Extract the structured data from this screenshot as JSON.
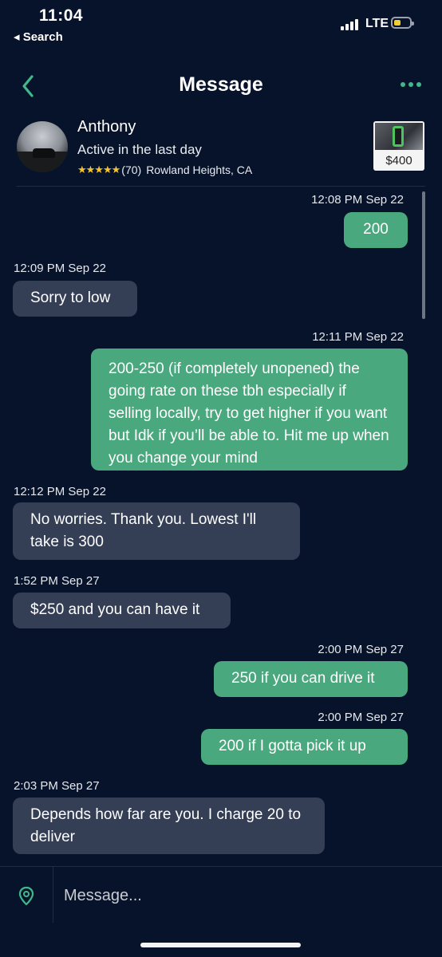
{
  "status_bar": {
    "time": "11:04",
    "back_label": "◂ Search",
    "network": "LTE",
    "battery_color": "#f3cf2b"
  },
  "nav": {
    "title": "Message",
    "accent_color": "#3fb88a"
  },
  "profile": {
    "name": "Anthony",
    "activity": "Active in the last day",
    "stars": "★★★★★",
    "rating_count": "(70)",
    "location": "Rowland Heights, CA",
    "listing_price": "$400"
  },
  "messages": [
    {
      "time": "12:08 PM Sep 22",
      "direction": "out",
      "text": "200"
    },
    {
      "time": "12:09 PM Sep 22",
      "direction": "in",
      "text": "Sorry to low"
    },
    {
      "time": "12:11 PM Sep 22",
      "direction": "out",
      "text": "200-250 (if completely unopened) the going rate on these tbh especially if selling locally, try to get higher if you want but Idk if you’ll be able to. Hit me up when you change your mind"
    },
    {
      "time": "12:12 PM Sep 22",
      "direction": "in",
      "text": "No worries. Thank you. Lowest I'll take is 300"
    },
    {
      "time": "1:52 PM Sep 27",
      "direction": "in",
      "text": "$250 and you can have it"
    },
    {
      "time": "2:00 PM Sep 27",
      "direction": "out",
      "text": "250 if you can drive it"
    },
    {
      "time": "2:00 PM Sep 27",
      "direction": "out",
      "text": "200 if I gotta pick  it up"
    },
    {
      "time": "2:03 PM Sep 27",
      "direction": "in",
      "text": "Depends how far are you. I charge 20 to deliver"
    }
  ],
  "composer": {
    "placeholder": "Message...",
    "icon": "location-pin-icon"
  },
  "colors": {
    "background": "#07132a",
    "outgoing_bubble": "#4aa87e",
    "incoming_bubble": "#343e55",
    "star": "#f2c430"
  }
}
